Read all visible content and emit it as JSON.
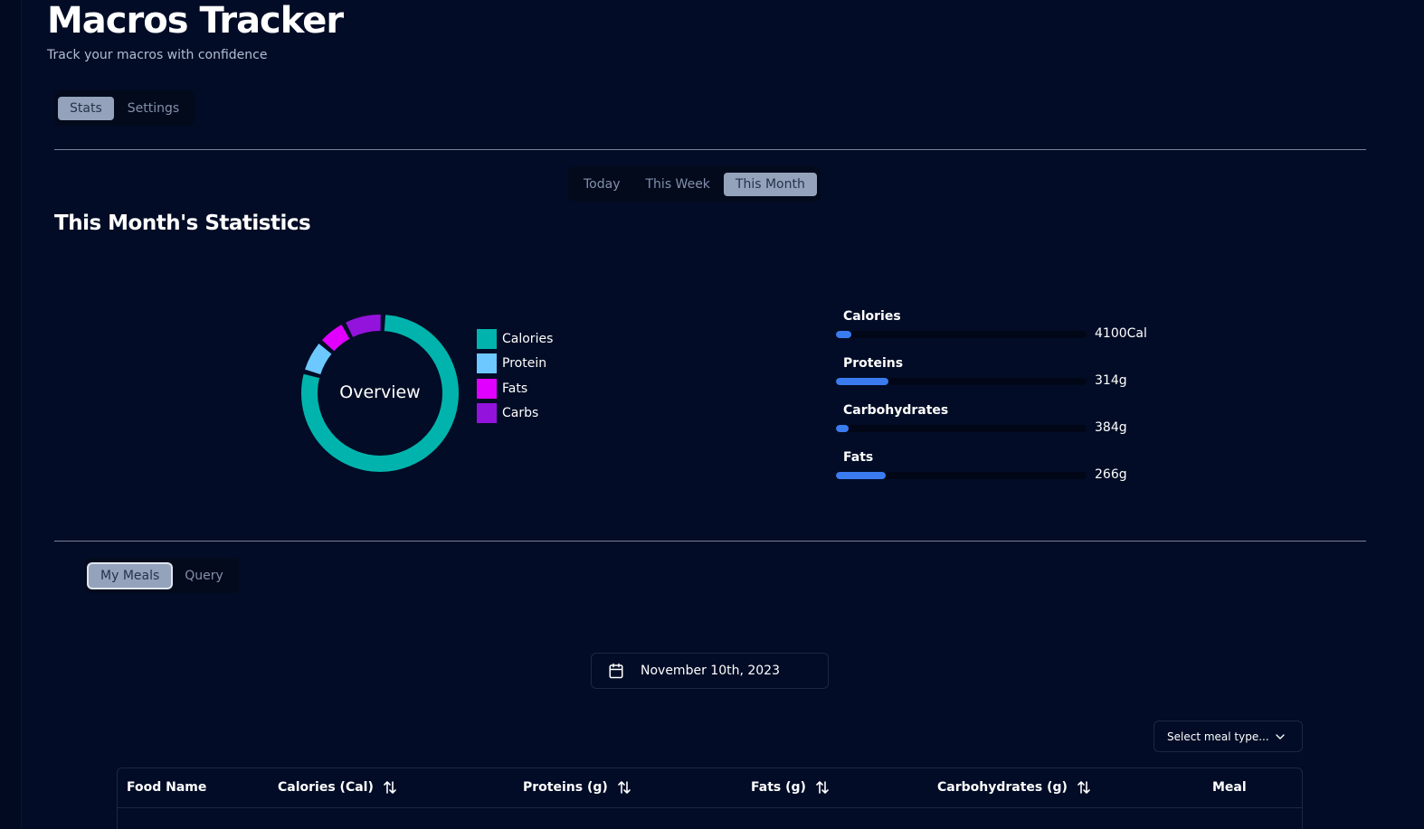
{
  "app": {
    "title": "Macros Tracker",
    "subtitle": "Track your macros with confidence"
  },
  "main_tabs": [
    {
      "label": "Stats",
      "active": true
    },
    {
      "label": "Settings",
      "active": false
    }
  ],
  "period_tabs": [
    {
      "label": "Today",
      "active": false
    },
    {
      "label": "This Week",
      "active": false
    },
    {
      "label": "This Month",
      "active": true
    }
  ],
  "stats": {
    "title": "This Month's Statistics",
    "donut_center_label": "Overview",
    "legend": [
      {
        "label": "Calories",
        "color": "#00b4ad"
      },
      {
        "label": "Protein",
        "color": "#6cc8ff"
      },
      {
        "label": "Fats",
        "color": "#e100ff"
      },
      {
        "label": "Carbs",
        "color": "#9413dc"
      }
    ],
    "bars": [
      {
        "label": "Calories",
        "value": "4100Cal",
        "fraction": 0.06
      },
      {
        "label": "Proteins",
        "value": "314g",
        "fraction": 0.21
      },
      {
        "label": "Carbohydrates",
        "value": "384g",
        "fraction": 0.05
      },
      {
        "label": "Fats",
        "value": "266g",
        "fraction": 0.2
      }
    ]
  },
  "chart_data": {
    "type": "pie",
    "categories": [
      "Calories",
      "Protein",
      "Fats",
      "Carbs"
    ],
    "values": [
      4100,
      314,
      266,
      384
    ],
    "title": "Overview"
  },
  "meals_tabs": [
    {
      "label": "My Meals",
      "active": true
    },
    {
      "label": "Query",
      "active": false
    }
  ],
  "date_picker": {
    "value": "November 10th, 2023",
    "icon": "calendar-icon"
  },
  "meal_select": {
    "placeholder": "Select meal type...",
    "icon": "chevron-down-icon"
  },
  "table": {
    "columns": [
      {
        "label": "Food Name",
        "sortable": false
      },
      {
        "label": "Calories (Cal)",
        "sortable": true
      },
      {
        "label": "Proteins (g)",
        "sortable": true
      },
      {
        "label": "Fats (g)",
        "sortable": true
      },
      {
        "label": "Carbohydrates (g)",
        "sortable": true
      },
      {
        "label": "Meal",
        "sortable": false
      }
    ]
  }
}
